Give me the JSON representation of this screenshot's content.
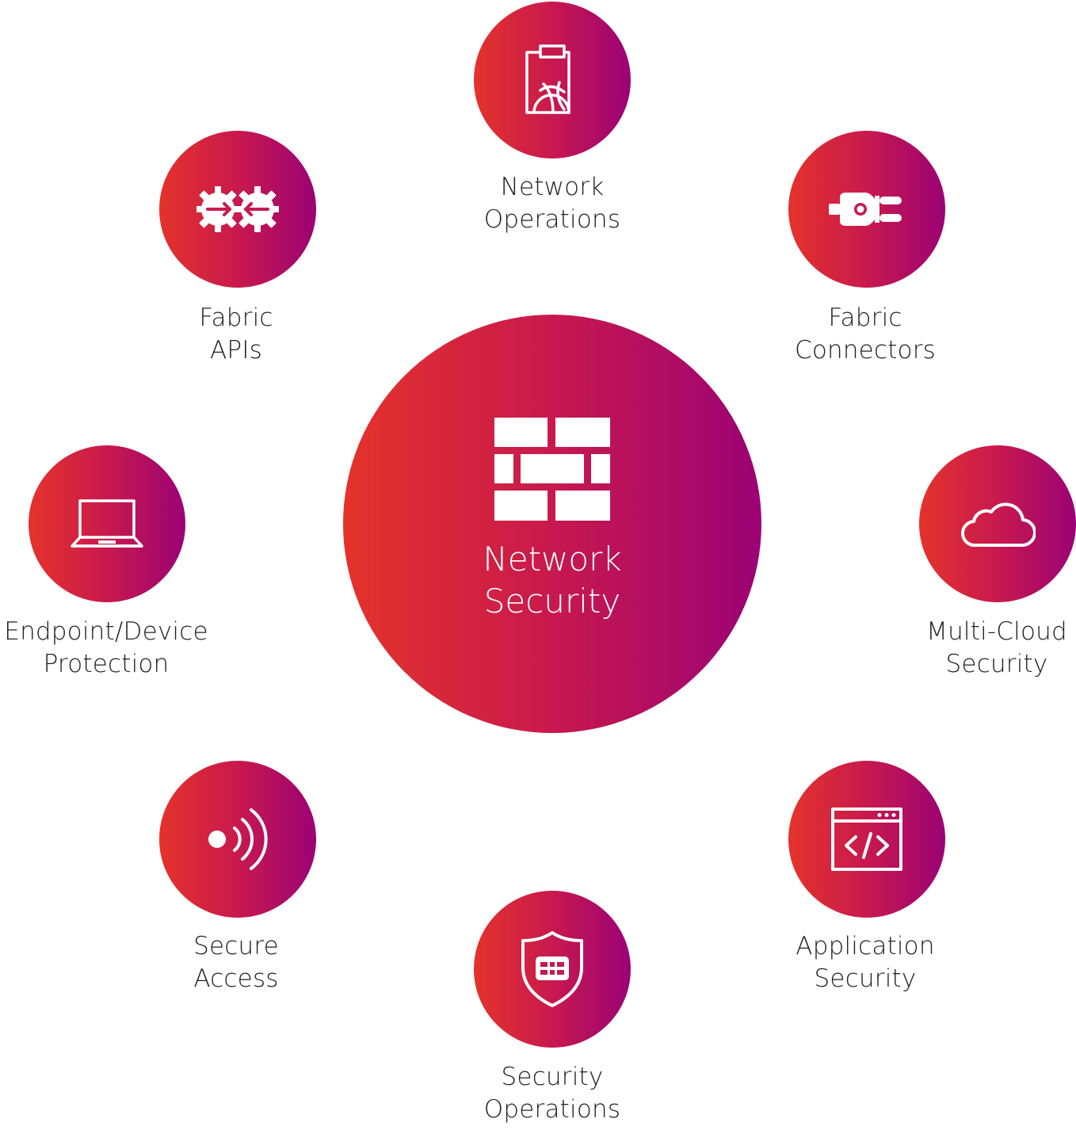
{
  "colors": {
    "gradient_start": "#e4332a",
    "gradient_mid": "#c8194e",
    "gradient_end": "#9b0275",
    "label_text": "#231f20",
    "icon": "#ffffff"
  },
  "center": {
    "icon": "firewall-brick-icon",
    "label_line1": "Network",
    "label_line2": "Security"
  },
  "nodes": [
    {
      "id": "network-operations",
      "icon": "clipboard-globe-icon",
      "line1": "Network",
      "line2": "Operations"
    },
    {
      "id": "fabric-connectors",
      "icon": "plug-connector-icon",
      "line1": "Fabric",
      "line2": "Connectors"
    },
    {
      "id": "multi-cloud-security",
      "icon": "cloud-icon",
      "line1": "Multi-Cloud",
      "line2": "Security"
    },
    {
      "id": "application-security",
      "icon": "code-window-icon",
      "line1": "Application",
      "line2": "Security"
    },
    {
      "id": "security-operations",
      "icon": "shield-icon",
      "line1": "Security",
      "line2": "Operations"
    },
    {
      "id": "secure-access",
      "icon": "wireless-signal-icon",
      "line1": "Secure",
      "line2": "Access"
    },
    {
      "id": "endpoint-device-protection",
      "icon": "laptop-icon",
      "line1": "Endpoint/Device",
      "line2": "Protection"
    },
    {
      "id": "fabric-apis",
      "icon": "gears-exchange-icon",
      "line1": "Fabric",
      "line2": "APIs"
    }
  ]
}
